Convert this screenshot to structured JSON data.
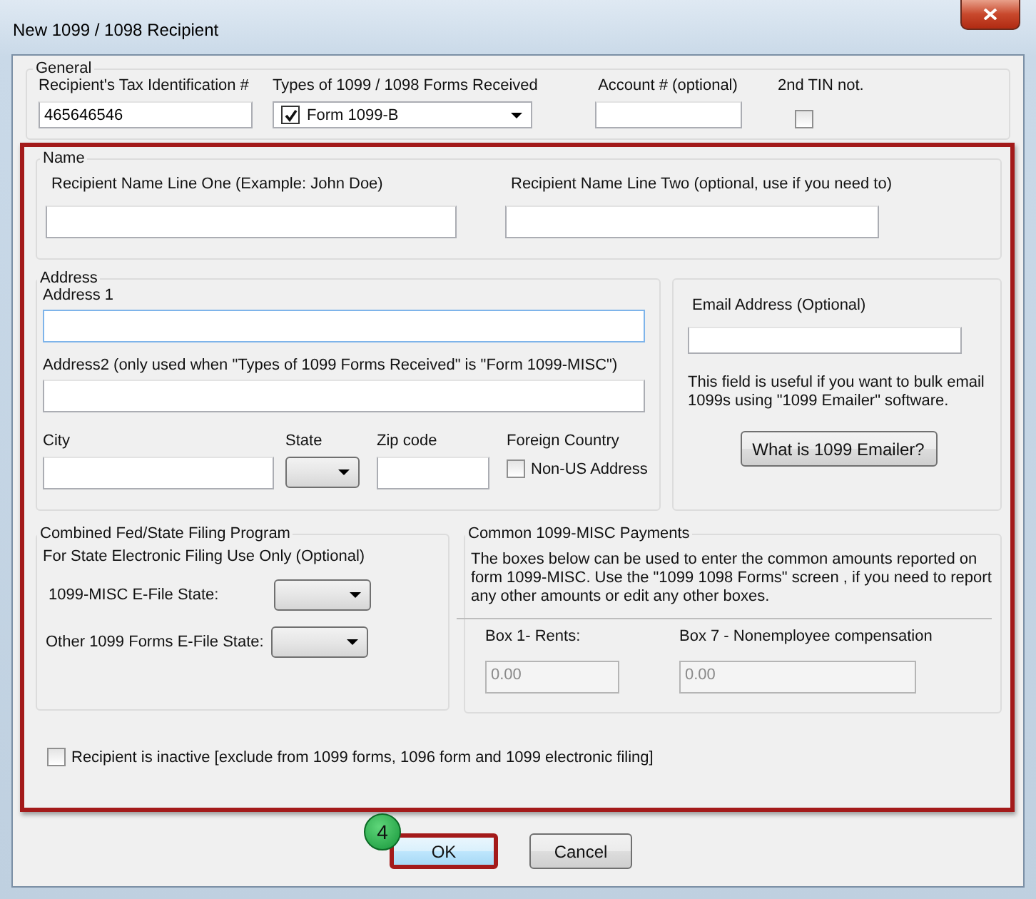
{
  "window": {
    "title": "New 1099 / 1098 Recipient"
  },
  "general": {
    "title": "General",
    "tin": {
      "label": "Recipient's Tax Identification #",
      "value": "465646546"
    },
    "form_types": {
      "label": "Types of 1099 / 1098 Forms Received",
      "checked": true,
      "value": "Form 1099-B"
    },
    "account": {
      "label": "Account # (optional)"
    },
    "second_tin": {
      "label": "2nd TIN not.",
      "checked": false
    }
  },
  "details_highlighted": true,
  "name": {
    "title": "Name",
    "line_one": {
      "label": "Recipient Name Line One (Example: John Doe)"
    },
    "line_two": {
      "label": "Recipient Name Line Two (optional, use if you need to)"
    }
  },
  "address": {
    "title": "Address",
    "address1": {
      "label": "Address 1",
      "focused": true
    },
    "address2": {
      "label": "Address2 (only used when \"Types of 1099 Forms Received\" is \"Form 1099-MISC\")"
    },
    "city": {
      "label": "City"
    },
    "state": {
      "label": "State"
    },
    "zip": {
      "label": "Zip code"
    },
    "foreign": {
      "label": "Foreign Country",
      "checkbox_label": "Non-US Address",
      "checked": false
    }
  },
  "email": {
    "label": "Email Address (Optional)",
    "note": "This field is useful if you want to bulk email 1099s using \"1099 Emailer\" software.",
    "button": "What is 1099 Emailer?"
  },
  "state_filing": {
    "title": "Combined Fed/State Filing Program",
    "note": "For State Electronic Filing Use Only (Optional)",
    "fields": [
      {
        "label": "1099-MISC E-File State:"
      },
      {
        "label": "Other 1099 Forms E-File State:"
      }
    ]
  },
  "payments": {
    "title": "Common 1099-MISC Payments",
    "note": "The boxes below can be used to enter the common amounts reported on form 1099-MISC. Use the \"1099  1098 Forms\" screen , if you need to report any other amounts or edit any other boxes.",
    "boxes": [
      {
        "label": "Box 1- Rents:",
        "value": "0.00",
        "disabled": true
      },
      {
        "label": "Box 7 - Nonemployee compensation",
        "value": "0.00",
        "disabled": true
      }
    ]
  },
  "inactive": {
    "label": "Recipient is inactive [exclude from 1099 forms, 1096 form and 1099 electronic filing]",
    "checked": false
  },
  "buttons": [
    {
      "label": "OK",
      "highlighted": true
    },
    {
      "label": "Cancel",
      "highlighted": false
    }
  ],
  "annotation": {
    "step": "4"
  }
}
